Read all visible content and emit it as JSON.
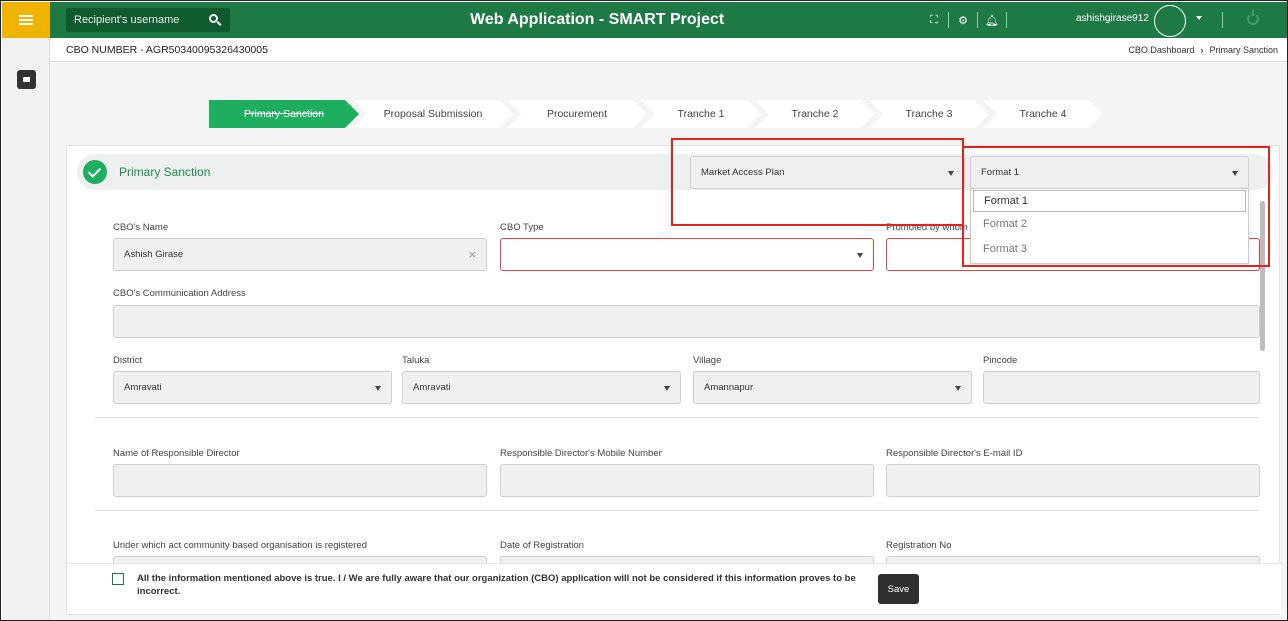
{
  "header": {
    "search_placeholder": "Recipient's username",
    "title": "Web Application - SMART Project",
    "username": "ashishgirase912"
  },
  "subheader": {
    "cbo_number": "CBO NUMBER - AGR50340095326430005",
    "breadcrumb": [
      "CBO Dashboard",
      "Primary Sanction"
    ]
  },
  "stepper": [
    {
      "label": "Primary Sanction",
      "active": true
    },
    {
      "label": "Proposal Submission"
    },
    {
      "label": "Procurement"
    },
    {
      "label": "Tranche 1"
    },
    {
      "label": "Tranche 2"
    },
    {
      "label": "Tranche 3"
    },
    {
      "label": "Tranche 4"
    }
  ],
  "section": {
    "title": "Primary Sanction",
    "plan_select": "Market Access Plan",
    "format_select": "Format 1",
    "format_options": [
      "Format 1",
      "Format 2",
      "Format 3"
    ]
  },
  "form": {
    "cbo_name_label": "CBO's Name",
    "cbo_name_value": "Ashish Girase",
    "cbo_type_label": "CBO Type",
    "promoted_label": "Promoted by whom",
    "address_label": "CBO's Communication Address",
    "district_label": "District",
    "district_value": "Amravati",
    "taluka_label": "Taluka",
    "taluka_value": "Amravati",
    "village_label": "Village",
    "village_value": "Amannapur",
    "pincode_label": "Pincode",
    "director_name_label": "Name of Responsible Director",
    "director_mobile_label": "Responsible Director's Mobile Number",
    "director_email_label": "Responsible Director's E-mail ID",
    "act_label": "Under which act community based organisation is registered",
    "reg_date_label": "Date of Registration",
    "reg_no_label": "Registration No"
  },
  "footer": {
    "consent_text": "All the information mentioned above is true. I / We are fully aware that our organization (CBO) application will not be considered if this information proves to be incorrect.",
    "save_label": "Save"
  },
  "colors": {
    "header_green": "#1e7a45",
    "accent_green": "#1eae5f",
    "menu_yellow": "#f0b400",
    "highlight_red": "#e2231a"
  }
}
